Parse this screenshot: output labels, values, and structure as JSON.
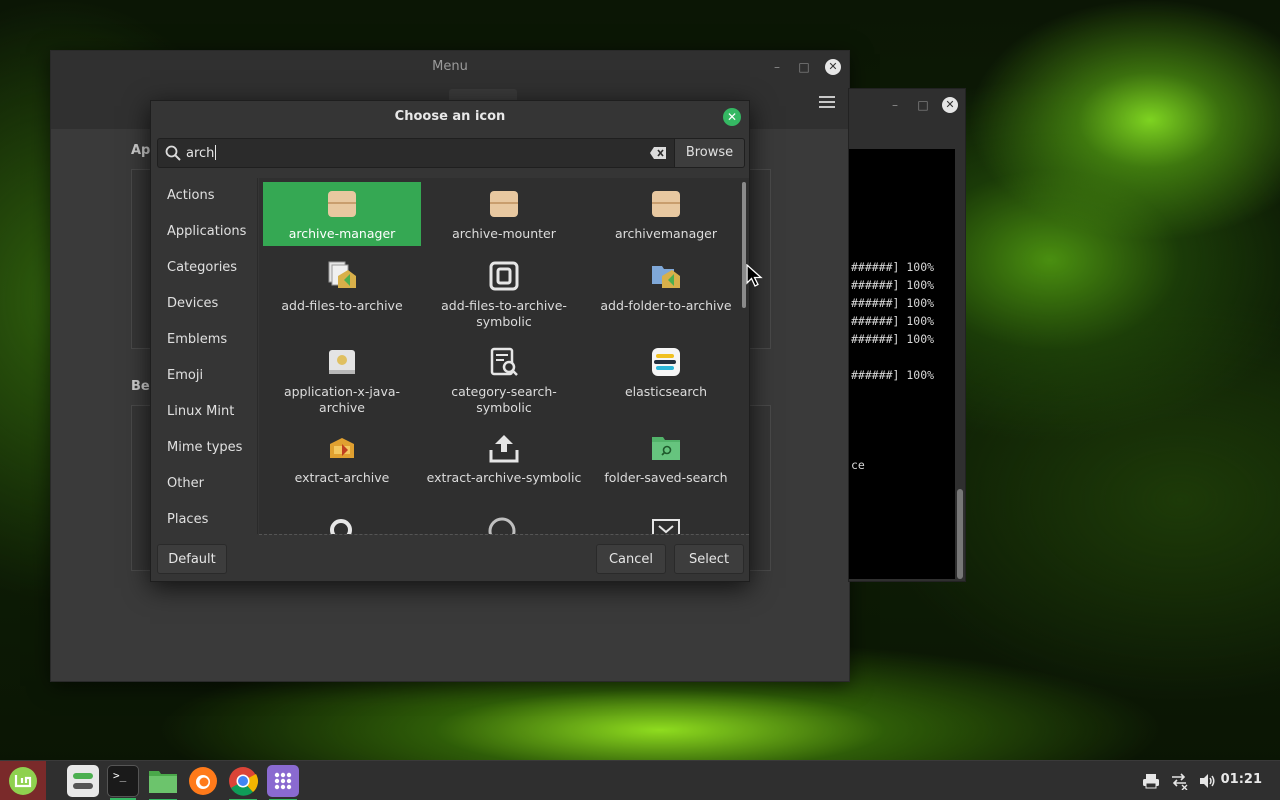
{
  "menu_window": {
    "title": "Menu",
    "section1_label": "Ap",
    "section2_label": "Bel"
  },
  "terminal": {
    "lines": [
      "######] 100%",
      "######] 100%",
      "######] 100%",
      "######] 100%",
      "######] 100%",
      "######] 100%",
      "ce"
    ]
  },
  "dialog": {
    "title": "Choose an icon",
    "search_value": "arch",
    "browse_label": "Browse",
    "categories": [
      "Actions",
      "Applications",
      "Categories",
      "Devices",
      "Emblems",
      "Emoji",
      "Linux Mint",
      "Mime types",
      "Other",
      "Places"
    ],
    "icons": [
      {
        "label": "archive-manager",
        "icon": "archive-box-icon",
        "selected": true
      },
      {
        "label": "archive-mounter",
        "icon": "archive-box-icon"
      },
      {
        "label": "archivemanager",
        "icon": "archive-box-icon"
      },
      {
        "label": "add-files-to-archive",
        "icon": "add-files-icon"
      },
      {
        "label": "add-files-to-archive-symbolic",
        "icon": "archive-symbolic-icon"
      },
      {
        "label": "add-folder-to-archive",
        "icon": "add-folder-icon"
      },
      {
        "label": "application-x-java-archive",
        "icon": "java-archive-icon"
      },
      {
        "label": "category-search-symbolic",
        "icon": "document-search-icon"
      },
      {
        "label": "elasticsearch",
        "icon": "elasticsearch-icon"
      },
      {
        "label": "extract-archive",
        "icon": "extract-archive-icon"
      },
      {
        "label": "extract-archive-symbolic",
        "icon": "upload-icon"
      },
      {
        "label": "folder-saved-search",
        "icon": "folder-search-icon"
      }
    ],
    "default_label": "Default",
    "cancel_label": "Cancel",
    "select_label": "Select"
  },
  "taskbar": {
    "clock": "01:21",
    "apps": [
      "mint-menu-icon",
      "system-settings-icon",
      "terminal-icon",
      "files-icon",
      "firefox-icon",
      "chrome-icon",
      "app-grid-icon"
    ]
  },
  "colors": {
    "accent": "#35a853",
    "close_green": "#35b863"
  }
}
